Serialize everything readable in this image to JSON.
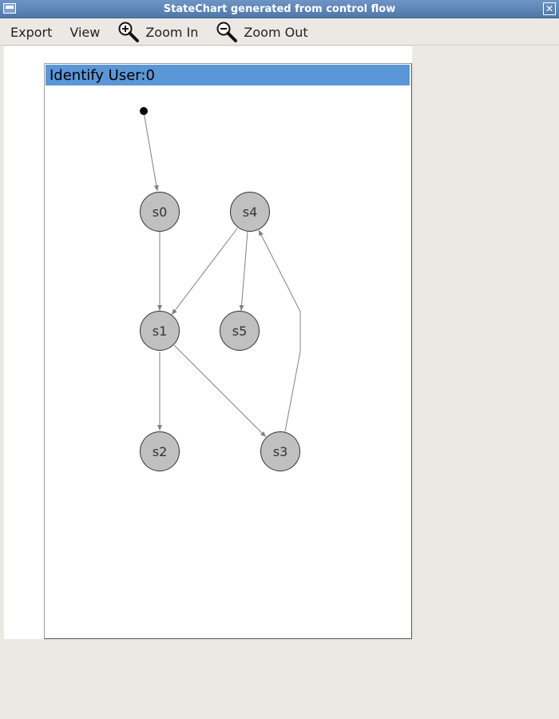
{
  "window": {
    "title": "StateChart generated from control flow"
  },
  "menu": {
    "export": "Export",
    "view": "View",
    "zoom_in": "Zoom In",
    "zoom_out": "Zoom Out"
  },
  "chart": {
    "header": "Identify User:0",
    "nodes": {
      "s0": "s0",
      "s1": "s1",
      "s2": "s2",
      "s3": "s3",
      "s4": "s4",
      "s5": "s5"
    }
  },
  "colors": {
    "titlebar": "#5b82b5",
    "header": "#5b96d6",
    "node_fill": "#c0c0c0",
    "edge": "#808080"
  }
}
